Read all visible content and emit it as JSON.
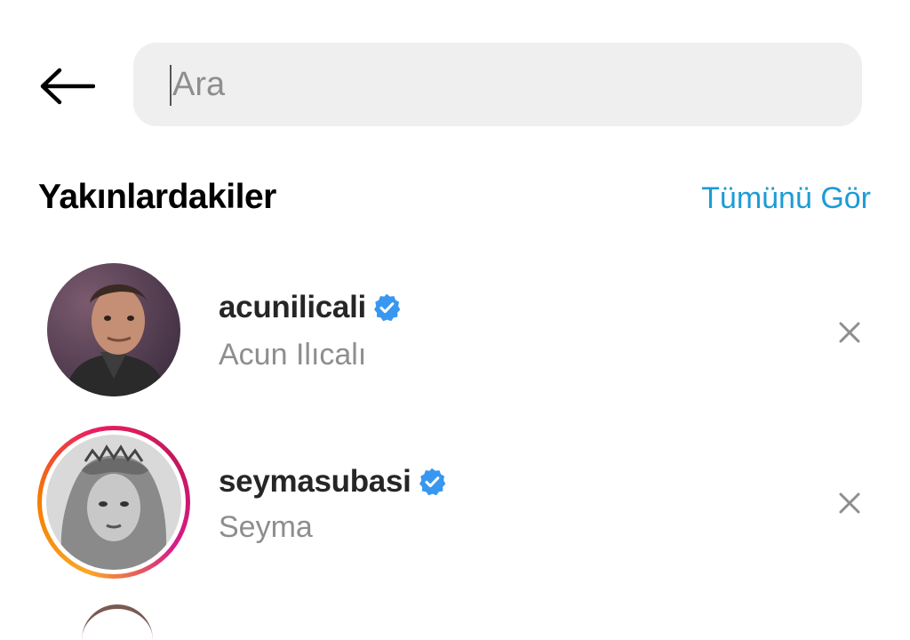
{
  "header": {
    "back_icon": "arrow-left-icon",
    "search": {
      "placeholder": "Ara",
      "value": ""
    }
  },
  "section": {
    "title": "Yakınlardakiler",
    "see_all_label": "Tümünü Gör",
    "accent_color": "#1d9bd6"
  },
  "results": [
    {
      "username": "acunilicali",
      "full_name": "Acun Ilıcalı",
      "verified": true,
      "has_story_ring": false,
      "remove_icon": "close-icon"
    },
    {
      "username": "seymasubasi",
      "full_name": "Seyma",
      "verified": true,
      "has_story_ring": true,
      "remove_icon": "close-icon"
    }
  ],
  "colors": {
    "verified_badge": "#3897f0",
    "search_bg": "#efefef",
    "secondary_text": "#8e8e8e"
  }
}
